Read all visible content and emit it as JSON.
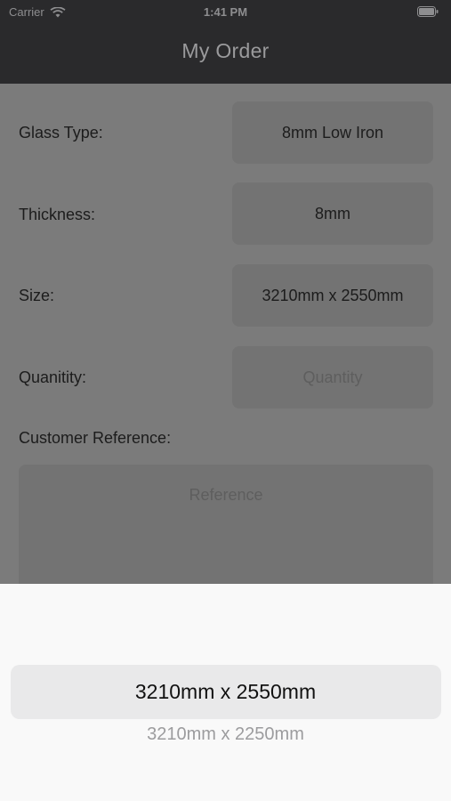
{
  "status_bar": {
    "carrier": "Carrier",
    "time": "1:41 PM",
    "wifi_icon": "wifi-icon",
    "battery_icon": "battery-icon"
  },
  "nav": {
    "title": "My Order"
  },
  "form": {
    "glass_type": {
      "label": "Glass Type:",
      "value": "8mm Low Iron"
    },
    "thickness": {
      "label": "Thickness:",
      "value": "8mm"
    },
    "size": {
      "label": "Size:",
      "value": "3210mm x 2550mm"
    },
    "quantity": {
      "label": "Quanitity:",
      "placeholder": "Quantity"
    },
    "customer_reference": {
      "label": "Customer Reference:",
      "placeholder": "Reference"
    }
  },
  "picker": {
    "selected": "3210mm x 2550mm",
    "options": [
      "3210mm x 2250mm"
    ]
  },
  "colors": {
    "header_bg": "#2a2a2c",
    "dim_overlay": "#7b7b7b",
    "picker_bg": "#f9f9f9"
  }
}
